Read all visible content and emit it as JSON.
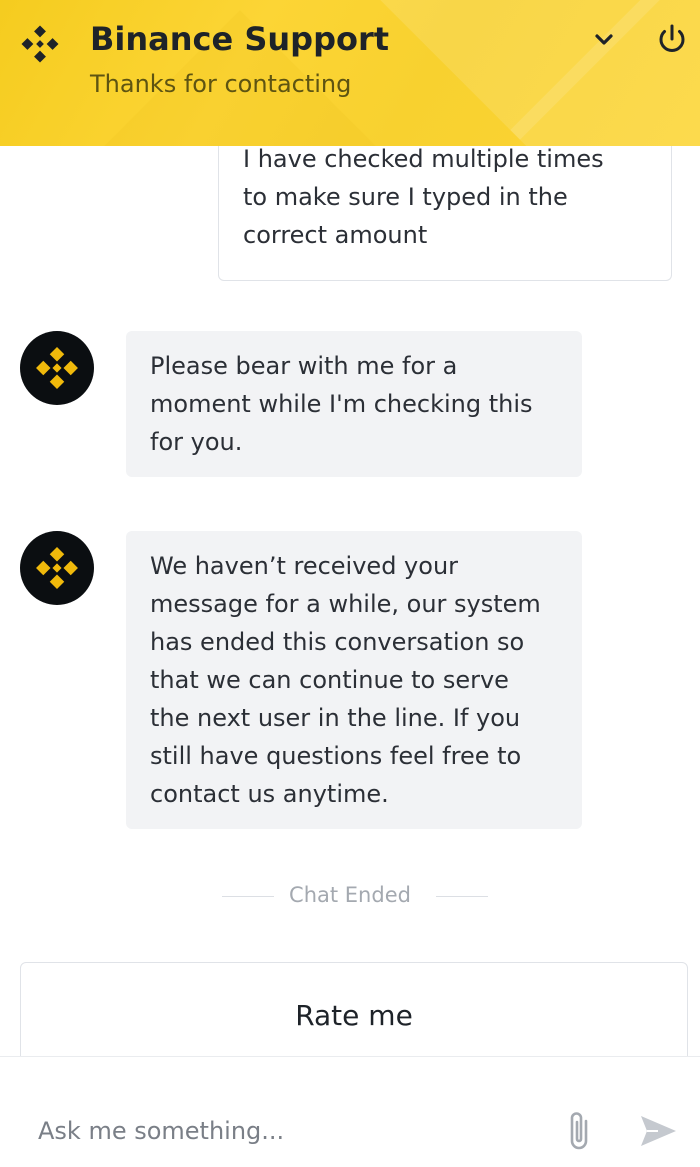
{
  "header": {
    "title": "Binance Support",
    "subtitle": "Thanks for contacting",
    "brand_color": "#FCD535"
  },
  "messages": [
    {
      "sender": "user",
      "lines": [
        "I have checked multiple times",
        "to make sure I typed in the",
        "correct amount"
      ]
    },
    {
      "sender": "bot",
      "lines": [
        "Please bear with me for a",
        "moment while I'm checking this",
        "for you."
      ]
    },
    {
      "sender": "bot",
      "lines": [
        "We haven’t received your",
        "message for a while, our system",
        "has ended this conversation so",
        "that we can continue to serve",
        "the next user in the line. If you",
        "still have questions feel free to",
        "contact us anytime."
      ]
    }
  ],
  "status": {
    "chat_ended": "Chat Ended"
  },
  "rate": {
    "label": "Rate me"
  },
  "composer": {
    "placeholder": "Ask me something..."
  },
  "icons": {
    "logo": "binance-logo-icon",
    "collapse": "chevron-down-icon",
    "end": "power-icon",
    "avatar": "binance-avatar-icon",
    "attach": "paperclip-icon",
    "send": "send-icon"
  }
}
